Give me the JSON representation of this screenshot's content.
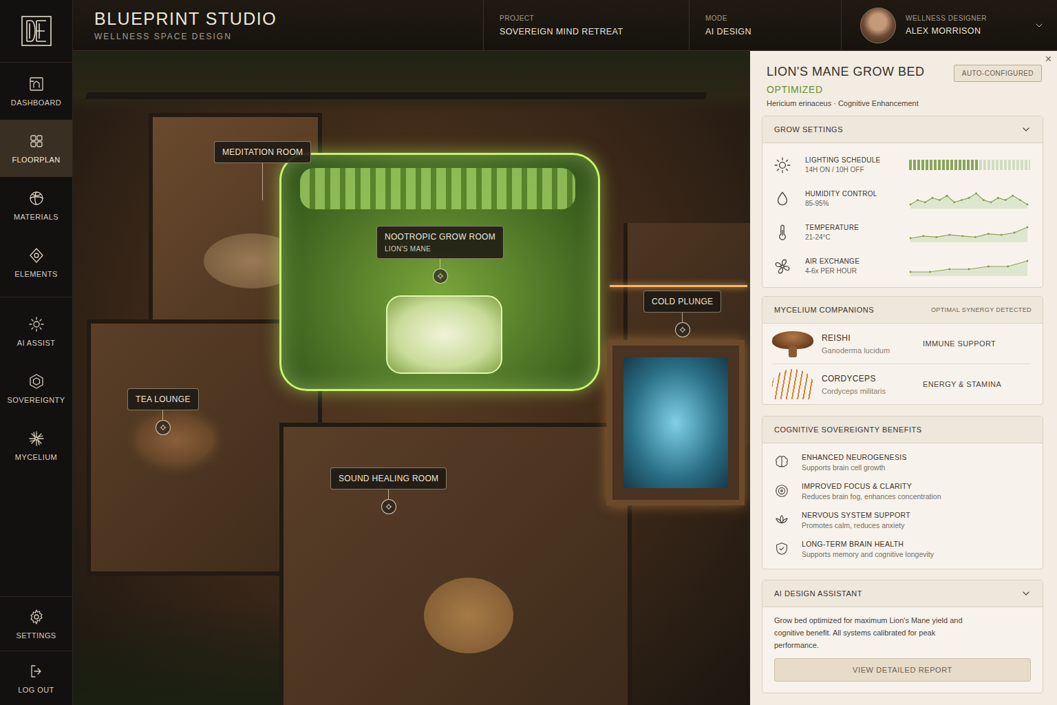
{
  "brand": {
    "title": "BLUEPRINT STUDIO",
    "subtitle": "WELLNESS SPACE DESIGN"
  },
  "header": {
    "project": {
      "label": "PROJECT",
      "value": "SOVEREIGN MIND RETREAT"
    },
    "mode": {
      "label": "MODE",
      "value": "AI DESIGN"
    },
    "user": {
      "role": "WELLNESS DESIGNER",
      "name": "ALEX MORRISON",
      "menu_open": false
    }
  },
  "sidebar": {
    "items": [
      {
        "label": "DASHBOARD",
        "selected": false
      },
      {
        "label": "FLOORPLAN",
        "selected": true
      },
      {
        "label": "MATERIALS",
        "selected": false
      },
      {
        "label": "ELEMENTS",
        "selected": false
      },
      {
        "label": "AI ASSIST",
        "selected": false
      },
      {
        "label": "SOVEREIGNTY",
        "selected": false
      },
      {
        "label": "MYCELIUM",
        "selected": false
      }
    ],
    "footer": [
      {
        "label": "SETTINGS"
      },
      {
        "label": "LOG OUT"
      }
    ]
  },
  "floorplan": {
    "pins": [
      {
        "label": "MEDITATION ROOM",
        "kind": "plain"
      },
      {
        "label": "NOOTROPIC GROW ROOM",
        "sublabel": "LION'S MANE",
        "kind": "marker"
      },
      {
        "label": "COLD PLUNGE",
        "kind": "marker"
      },
      {
        "label": "TEA LOUNGE",
        "kind": "marker"
      },
      {
        "label": "SOUND HEALING ROOM",
        "kind": "marker"
      }
    ]
  },
  "panel": {
    "close": "×",
    "title": "LION'S MANE GROW BED",
    "status": "OPTIMIZED",
    "badge": "AUTO-CONFIGURED",
    "subtitle": "Hericium erinaceus · Cognitive Enhancement",
    "grow_settings": {
      "title": "GROW SETTINGS",
      "expanded": true,
      "rows": [
        {
          "kind": "segments",
          "label": "LIGHTING SCHEDULE",
          "value": "14H ON / 10H OFF",
          "level": 0.58
        },
        {
          "kind": "sparkline",
          "label": "HUMIDITY CONTROL",
          "value": "85-95%",
          "values": [
            88,
            90,
            89,
            91,
            90,
            92,
            89,
            90,
            91,
            93,
            90,
            89,
            91,
            90,
            92,
            90,
            88
          ]
        },
        {
          "kind": "sparkline",
          "label": "TEMPERATURE",
          "value": "21-24°C",
          "values": [
            22.0,
            22.2,
            22.1,
            22.3,
            22.2,
            22.1,
            22.4,
            22.3,
            22.5,
            23.0
          ]
        },
        {
          "kind": "sparkline",
          "label": "AIR EXCHANGE",
          "value": "4-6x PER HOUR",
          "values": [
            5.0,
            5.0,
            5.1,
            5.1,
            5.2,
            5.2,
            5.4
          ]
        }
      ]
    },
    "companions": {
      "title": "MYCELIUM COMPANIONS",
      "status": "OPTIMAL SYNERGY DETECTED",
      "items": [
        {
          "name": "REISHI",
          "latin": "Ganoderma lucidum",
          "benefit": "IMMUNE SUPPORT",
          "kind": "cap"
        },
        {
          "name": "CORDYCEPS",
          "latin": "Cordyceps militaris",
          "benefit": "ENERGY & STAMINA",
          "kind": "coral"
        }
      ]
    },
    "benefits": {
      "title": "COGNITIVE SOVEREIGNTY BENEFITS",
      "items": [
        {
          "title": "ENHANCED NEUROGENESIS",
          "desc": "Supports brain cell growth"
        },
        {
          "title": "IMPROVED FOCUS & CLARITY",
          "desc": "Reduces brain fog, enhances concentration"
        },
        {
          "title": "NERVOUS SYSTEM SUPPORT",
          "desc": "Promotes calm, reduces anxiety"
        },
        {
          "title": "LONG-TERM BRAIN HEALTH",
          "desc": "Supports memory and cognitive longevity"
        }
      ]
    },
    "assistant": {
      "title": "AI DESIGN ASSISTANT",
      "expanded": true,
      "message": "Grow bed optimized for maximum Lion's Mane yield and cognitive benefit. All systems calibrated for peak performance.",
      "button": "VIEW DETAILED REPORT"
    }
  }
}
